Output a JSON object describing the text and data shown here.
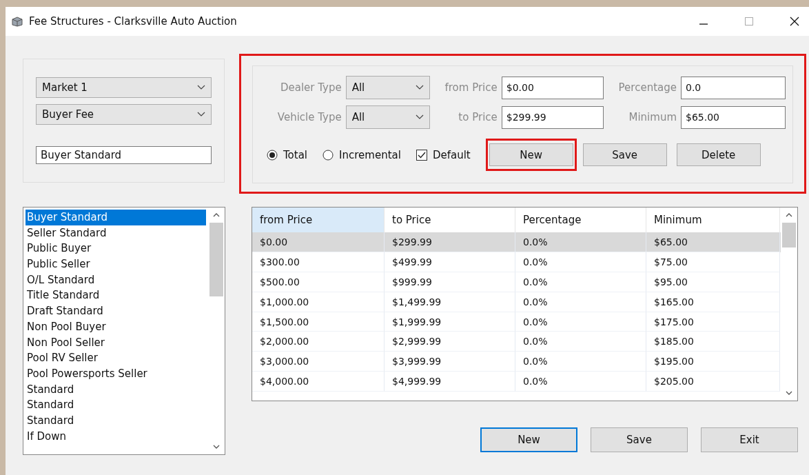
{
  "window": {
    "title": "Fee Structures - Clarksville Auto Auction"
  },
  "selectors": {
    "market": "Market 1",
    "fee_type": "Buyer Fee",
    "name": "Buyer Standard"
  },
  "criteria": {
    "highlighted": true,
    "fields": [
      {
        "label": "Dealer Type",
        "kind": "select",
        "value": "All"
      },
      {
        "label": "from Price",
        "kind": "text",
        "value": "$0.00"
      },
      {
        "label": "Percentage",
        "kind": "text",
        "value": "0.0"
      },
      {
        "label": "Vehicle Type",
        "kind": "select",
        "value": "All"
      },
      {
        "label": "to Price",
        "kind": "text",
        "value": "$299.99"
      },
      {
        "label": "Minimum",
        "kind": "text",
        "value": "$65.00"
      }
    ],
    "mode": [
      {
        "label": "Total",
        "selected": true
      },
      {
        "label": "Incremental",
        "selected": false
      }
    ],
    "default": {
      "label": "Default",
      "checked": true
    },
    "buttons": [
      {
        "label": "New",
        "highlighted": true
      },
      {
        "label": "Save",
        "highlighted": false
      },
      {
        "label": "Delete",
        "highlighted": false
      }
    ]
  },
  "fee_list": {
    "items": [
      {
        "label": "Buyer Standard",
        "selected": true
      },
      {
        "label": "Seller Standard",
        "selected": false
      },
      {
        "label": "Public Buyer",
        "selected": false
      },
      {
        "label": "Public Seller",
        "selected": false
      },
      {
        "label": "O/L Standard",
        "selected": false
      },
      {
        "label": "Title Standard",
        "selected": false
      },
      {
        "label": "Draft Standard",
        "selected": false
      },
      {
        "label": "Non Pool Buyer",
        "selected": false
      },
      {
        "label": "Non Pool Seller",
        "selected": false
      },
      {
        "label": "Pool RV Seller",
        "selected": false
      },
      {
        "label": "Pool Powersports Seller",
        "selected": false
      },
      {
        "label": "Standard",
        "selected": false
      },
      {
        "label": "Standard",
        "selected": false
      },
      {
        "label": "Standard",
        "selected": false
      },
      {
        "label": "If Down",
        "selected": false
      }
    ]
  },
  "table": {
    "columns": [
      {
        "label": "from Price",
        "selected": true
      },
      {
        "label": "to Price",
        "selected": false
      },
      {
        "label": "Percentage",
        "selected": false
      },
      {
        "label": "Minimum",
        "selected": false
      }
    ],
    "rows": [
      {
        "cells": [
          "$0.00",
          "$299.99",
          "0.0%",
          "$65.00"
        ],
        "selected": true
      },
      {
        "cells": [
          "$300.00",
          "$499.99",
          "0.0%",
          "$75.00"
        ],
        "selected": false
      },
      {
        "cells": [
          "$500.00",
          "$999.99",
          "0.0%",
          "$95.00"
        ],
        "selected": false
      },
      {
        "cells": [
          "$1,000.00",
          "$1,499.99",
          "0.0%",
          "$165.00"
        ],
        "selected": false
      },
      {
        "cells": [
          "$1,500.00",
          "$1,999.99",
          "0.0%",
          "$175.00"
        ],
        "selected": false
      },
      {
        "cells": [
          "$2,000.00",
          "$2,999.99",
          "0.0%",
          "$185.00"
        ],
        "selected": false
      },
      {
        "cells": [
          "$3,000.00",
          "$3,999.99",
          "0.0%",
          "$195.00"
        ],
        "selected": false
      },
      {
        "cells": [
          "$4,000.00",
          "$4,999.99",
          "0.0%",
          "$205.00"
        ],
        "selected": false
      }
    ]
  },
  "buttons": [
    {
      "label": "New",
      "focused": true
    },
    {
      "label": "Save",
      "focused": false
    },
    {
      "label": "Exit",
      "focused": false
    }
  ]
}
